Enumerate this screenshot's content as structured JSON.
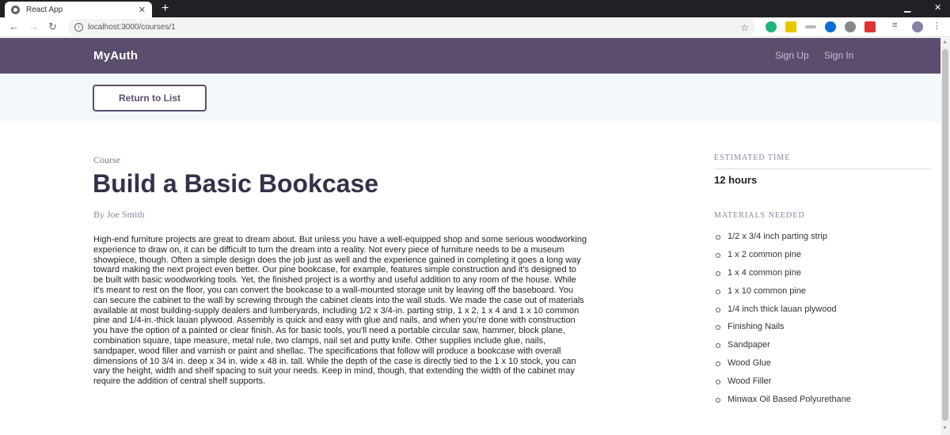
{
  "browser": {
    "tab_title": "React App",
    "new_tab": "+",
    "url": "localhost:3000/courses/1",
    "info": "i"
  },
  "navbar": {
    "brand": "MyAuth",
    "sign_up": "Sign Up",
    "sign_in": "Sign In"
  },
  "actions": {
    "return_label": "Return to List"
  },
  "course": {
    "label": "Course",
    "title": "Build a Basic Bookcase",
    "author": "By Joe Smith",
    "description": "High-end furniture projects are great to dream about. But unless you have a well-equipped shop and some serious woodworking experience to draw on, it can be difficult to turn the dream into a reality. Not every piece of furniture needs to be a museum showpiece, though. Often a simple design does the job just as well and the experience gained in completing it goes a long way toward making the next project even better. Our pine bookcase, for example, features simple construction and it's designed to be built with basic woodworking tools. Yet, the finished project is a worthy and useful addition to any room of the house. While it's meant to rest on the floor, you can convert the bookcase to a wall-mounted storage unit by leaving off the baseboard. You can secure the cabinet to the wall by screwing through the cabinet cleats into the wall studs. We made the case out of materials available at most building-supply dealers and lumberyards, including 1/2 x 3/4-in. parting strip, 1 x 2, 1 x 4 and 1 x 10 common pine and 1/4-in.-thick lauan plywood. Assembly is quick and easy with glue and nails, and when you're done with construction you have the option of a painted or clear finish. As for basic tools, you'll need a portable circular saw, hammer, block plane, combination square, tape measure, metal rule, two clamps, nail set and putty knife. Other supplies include glue, nails, sandpaper, wood filler and varnish or paint and shellac. The specifications that follow will produce a bookcase with overall dimensions of 10 3/4 in. deep x 34 in. wide x 48 in. tall. While the depth of the case is directly tied to the 1 x 10 stock, you can vary the height, width and shelf spacing to suit your needs. Keep in mind, though, that extending the width of the cabinet may require the addition of central shelf supports."
  },
  "sidebar": {
    "estimated_time_heading": "Estimated Time",
    "estimated_time": "12 hours",
    "materials_heading": "Materials Needed",
    "materials": [
      "1/2 x 3/4 inch parting strip",
      "1 x 2 common pine",
      "1 x 4 common pine",
      "1 x 10 common pine",
      "1/4 inch thick lauan plywood",
      "Finishing Nails",
      "Sandpaper",
      "Wood Glue",
      "Wood Filler",
      "Minwax Oil Based Polyurethane"
    ]
  },
  "colors": {
    "navbar": "#5c4d6e",
    "actions_bar": "#f3f9fb",
    "title": "#37304a"
  }
}
